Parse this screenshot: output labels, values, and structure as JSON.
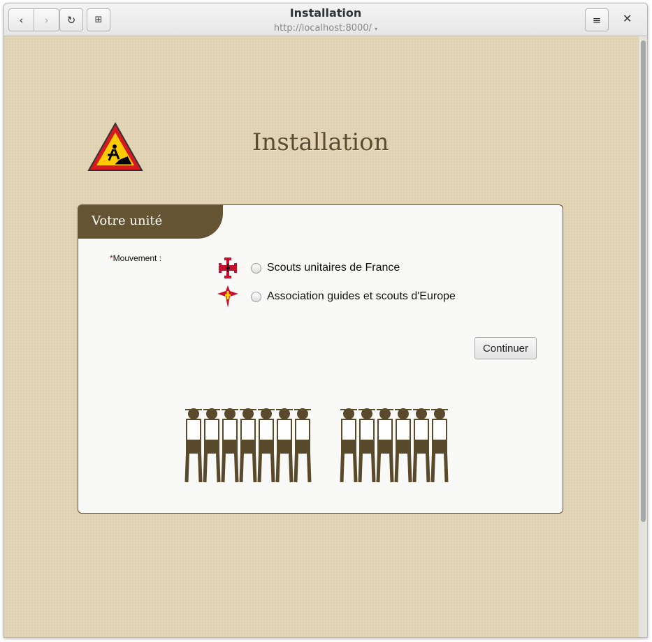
{
  "browser": {
    "title": "Installation",
    "url": "http://localhost:8000/"
  },
  "page": {
    "heading": "Installation",
    "card_title": "Votre unité",
    "field_label": "Mouvement :",
    "required_mark": "*",
    "options": [
      {
        "label": "Scouts unitaires de France"
      },
      {
        "label": "Association guides et scouts d'Europe"
      }
    ],
    "continue_label": "Continuer"
  },
  "colors": {
    "brand": "#645434",
    "background": "#dfd2b3",
    "accent_red": "#c8102e"
  }
}
